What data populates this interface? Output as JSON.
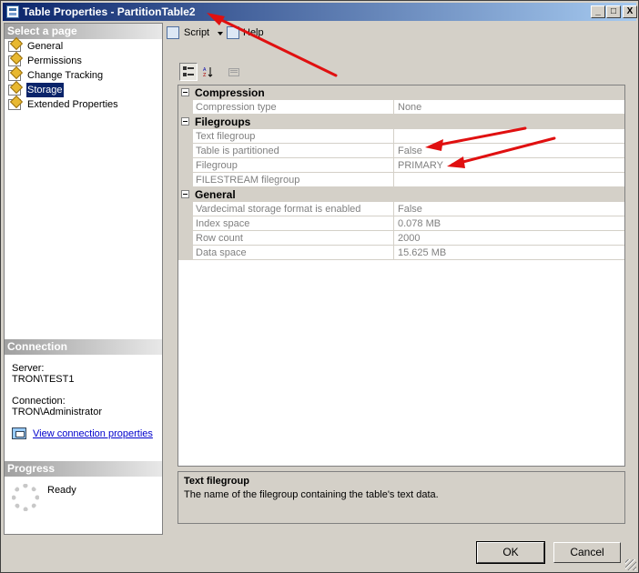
{
  "window": {
    "title": "Table Properties - PartitionTable2",
    "controls": {
      "minimize": "_",
      "maximize": "□",
      "close": "X"
    }
  },
  "left_pane": {
    "select_header": "Select a page",
    "pages": [
      {
        "label": "General",
        "icon": "page-icon",
        "selected": false
      },
      {
        "label": "Permissions",
        "icon": "page-icon",
        "selected": false
      },
      {
        "label": "Change Tracking",
        "icon": "page-icon",
        "selected": false
      },
      {
        "label": "Storage",
        "icon": "page-icon",
        "selected": true
      },
      {
        "label": "Extended Properties",
        "icon": "page-icon",
        "selected": false
      }
    ],
    "connection_header": "Connection",
    "server_label": "Server:",
    "server_value": "TRON\\TEST1",
    "connection_label": "Connection:",
    "connection_value": "TRON\\Administrator",
    "view_link": "View connection properties",
    "progress_header": "Progress",
    "progress_status": "Ready"
  },
  "toolbar": {
    "script_label": "Script",
    "help_label": "Help"
  },
  "grid": {
    "categories": [
      {
        "label": "Compression",
        "rows": [
          {
            "name": "Compression type",
            "value": "None"
          }
        ]
      },
      {
        "label": "Filegroups",
        "rows": [
          {
            "name": "Text filegroup",
            "value": ""
          },
          {
            "name": "Table is partitioned",
            "value": "False"
          },
          {
            "name": "Filegroup",
            "value": "PRIMARY"
          },
          {
            "name": "FILESTREAM filegroup",
            "value": ""
          }
        ]
      },
      {
        "label": "General",
        "rows": [
          {
            "name": "Vardecimal storage format is enabled",
            "value": "False"
          },
          {
            "name": "Index space",
            "value": "0.078 MB"
          },
          {
            "name": "Row count",
            "value": "2000"
          },
          {
            "name": "Data space",
            "value": "15.625 MB"
          }
        ]
      }
    ]
  },
  "description": {
    "title": "Text filegroup",
    "text": "The name of the filegroup containing the table's text data."
  },
  "buttons": {
    "ok": "OK",
    "cancel": "Cancel"
  },
  "colors": {
    "titlebar_start": "#0a246a",
    "titlebar_end": "#a6caf0",
    "annotation_arrow": "#e01010",
    "selection": "#0a246a"
  }
}
